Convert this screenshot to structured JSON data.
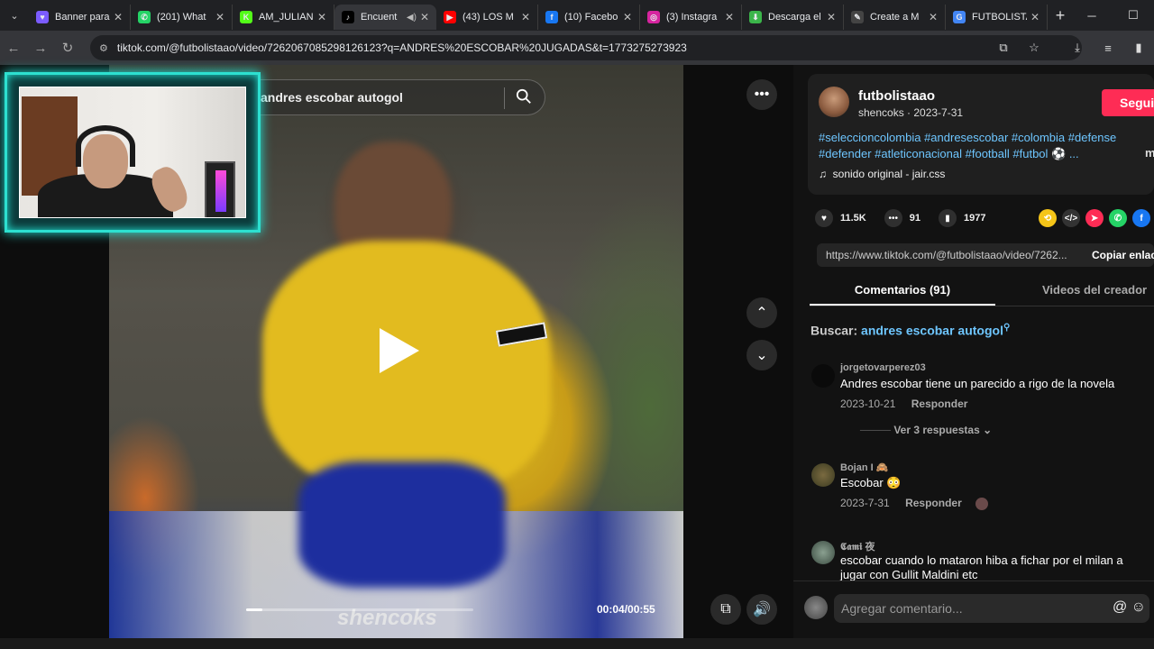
{
  "browser": {
    "tabs": [
      {
        "label": "Banner para",
        "color": "#7b5cff",
        "glyph": "♥"
      },
      {
        "label": "(201) What",
        "color": "#25d366",
        "glyph": "✆"
      },
      {
        "label": "AM_JULIAN",
        "color": "#53fc18",
        "glyph": "K"
      },
      {
        "label": "Encuent",
        "color": "#000000",
        "glyph": "♪",
        "active": true
      },
      {
        "label": "(43) LOS M",
        "color": "#ff0000",
        "glyph": "▶"
      },
      {
        "label": "(10) Facebo",
        "color": "#1877f2",
        "glyph": "f"
      },
      {
        "label": "(3) Instagra",
        "color": "#d6249f",
        "glyph": "◎"
      },
      {
        "label": "Descarga el",
        "color": "#3bb54a",
        "glyph": "⬇"
      },
      {
        "label": "Create a M",
        "color": "#444444",
        "glyph": "✎"
      },
      {
        "label": "FUTBOLISTA",
        "color": "#4285f4",
        "glyph": "G"
      }
    ],
    "url": "tiktok.com/@futbolistaao/video/7262067085298126123?q=ANDRES%20ESCOBAR%20JUGADAS&t=1773275273923"
  },
  "video": {
    "search_query": "andres escobar autogol",
    "watermark": "shencoks",
    "time": "00:04/00:55",
    "progress": 0.07
  },
  "author": {
    "name": "futbolistaao",
    "sub": "shencoks · 2023-7-31",
    "follow_label": "Seguir",
    "hashtags": "#seleccioncolombia #andresescobar #colombia #defense #defender #atleticonacional #football #futbol ⚽ ...",
    "more_label": "m",
    "music": "sonido original - jair.css"
  },
  "stats": {
    "likes": "11.5K",
    "comments": "91",
    "saves": "1977"
  },
  "share": {
    "link": "https://www.tiktok.com/@futbolistaao/video/7262...",
    "copy_label": "Copiar enlace"
  },
  "tabs": {
    "comments": "Comentarios (91)",
    "creator": "Videos del creador"
  },
  "comment_search": {
    "label": "Buscar:",
    "query": "andres escobar autogol"
  },
  "comments": [
    {
      "user": "jorgetovarperez03",
      "text": "Andres escobar tiene un parecido a rigo de la novela",
      "date": "2023-10-21",
      "reply": "Responder",
      "replies": "Ver 3 respuestas"
    },
    {
      "user": "Bojan I 🙈",
      "text": "Escobar 😳",
      "date": "2023-7-31",
      "reply": "Responder"
    },
    {
      "user": "𝕮𝖆𝖒𝖎 夜",
      "text": "escobar cuando lo mataron hiba a fichar por el milan a jugar con Gullit Maldini etc"
    }
  ],
  "comment_input": {
    "placeholder": "Agregar comentario..."
  }
}
